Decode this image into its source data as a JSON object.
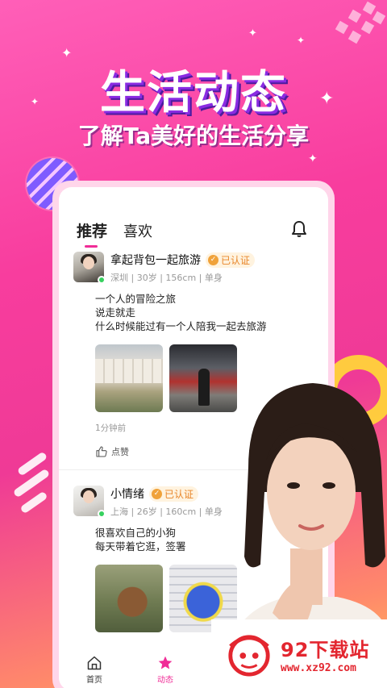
{
  "hero": {
    "title": "生活动态",
    "subtitle": "了解Ta美好的生活分享"
  },
  "tabs": [
    {
      "label": "推荐",
      "active": true
    },
    {
      "label": "喜欢",
      "active": false
    }
  ],
  "posts": [
    {
      "name": "拿起背包一起旅游",
      "badge": "已认证",
      "info": "深圳 | 30岁 | 156cm | 单身",
      "text": [
        "一个人的冒险之旅",
        "说走就走",
        "什么时候能过有一个人陪我一起去旅游"
      ],
      "time": "1分钟前",
      "like_label": "点赞",
      "online": true
    },
    {
      "name": "小情绪",
      "badge": "已认证",
      "info": "上海 | 26岁 | 160cm | 单身",
      "text": [
        "很喜欢自己的小狗",
        "每天带着它逛，签署"
      ],
      "online": true
    }
  ],
  "nav": [
    {
      "label": "首页",
      "icon": "home-icon",
      "active": false
    },
    {
      "label": "动态",
      "icon": "star-icon",
      "active": true
    }
  ],
  "watermark": {
    "title": "92下载站",
    "url": "www.xz92.com"
  },
  "colors": {
    "accent": "#f02c97",
    "badge": "#e8862a",
    "online": "#37d15f",
    "watermark": "#e3262f"
  }
}
